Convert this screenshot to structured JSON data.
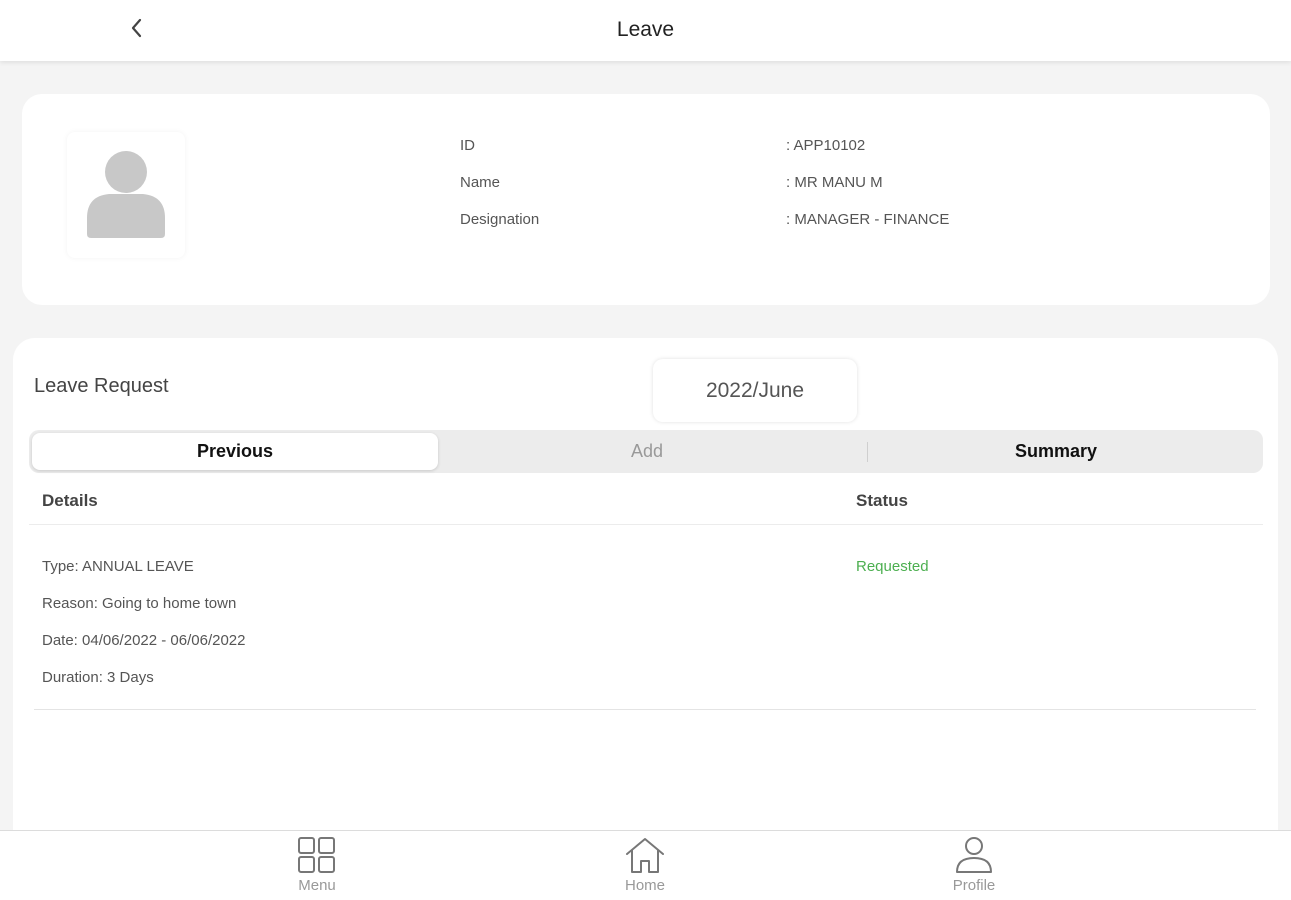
{
  "header": {
    "title": "Leave",
    "back_icon": "chevron-left-icon"
  },
  "profile": {
    "avatar_icon": "user-placeholder-icon",
    "fields": [
      {
        "label": "ID",
        "value": ": APP10102"
      },
      {
        "label": "Name",
        "value": ": MR MANU M"
      },
      {
        "label": "Designation",
        "value": ": MANAGER - FINANCE"
      }
    ]
  },
  "leave_request": {
    "title": "Leave Request",
    "month": "2022/June",
    "tabs": [
      {
        "label": "Previous",
        "state": "active"
      },
      {
        "label": "Add",
        "state": "disabled"
      },
      {
        "label": "Summary",
        "state": "normal"
      }
    ],
    "columns": {
      "details": "Details",
      "status": "Status"
    },
    "rows": [
      {
        "type": "Type: ANNUAL LEAVE",
        "reason": "Reason: Going to home town",
        "date": "Date: 04/06/2022 - 06/06/2022",
        "duration": "Duration: 3 Days",
        "status": "Requested",
        "status_color": "#4caf50"
      }
    ]
  },
  "bottom_nav": {
    "items": [
      {
        "label": "Menu",
        "icon": "grid-icon"
      },
      {
        "label": "Home",
        "icon": "home-icon"
      },
      {
        "label": "Profile",
        "icon": "person-icon"
      }
    ]
  }
}
